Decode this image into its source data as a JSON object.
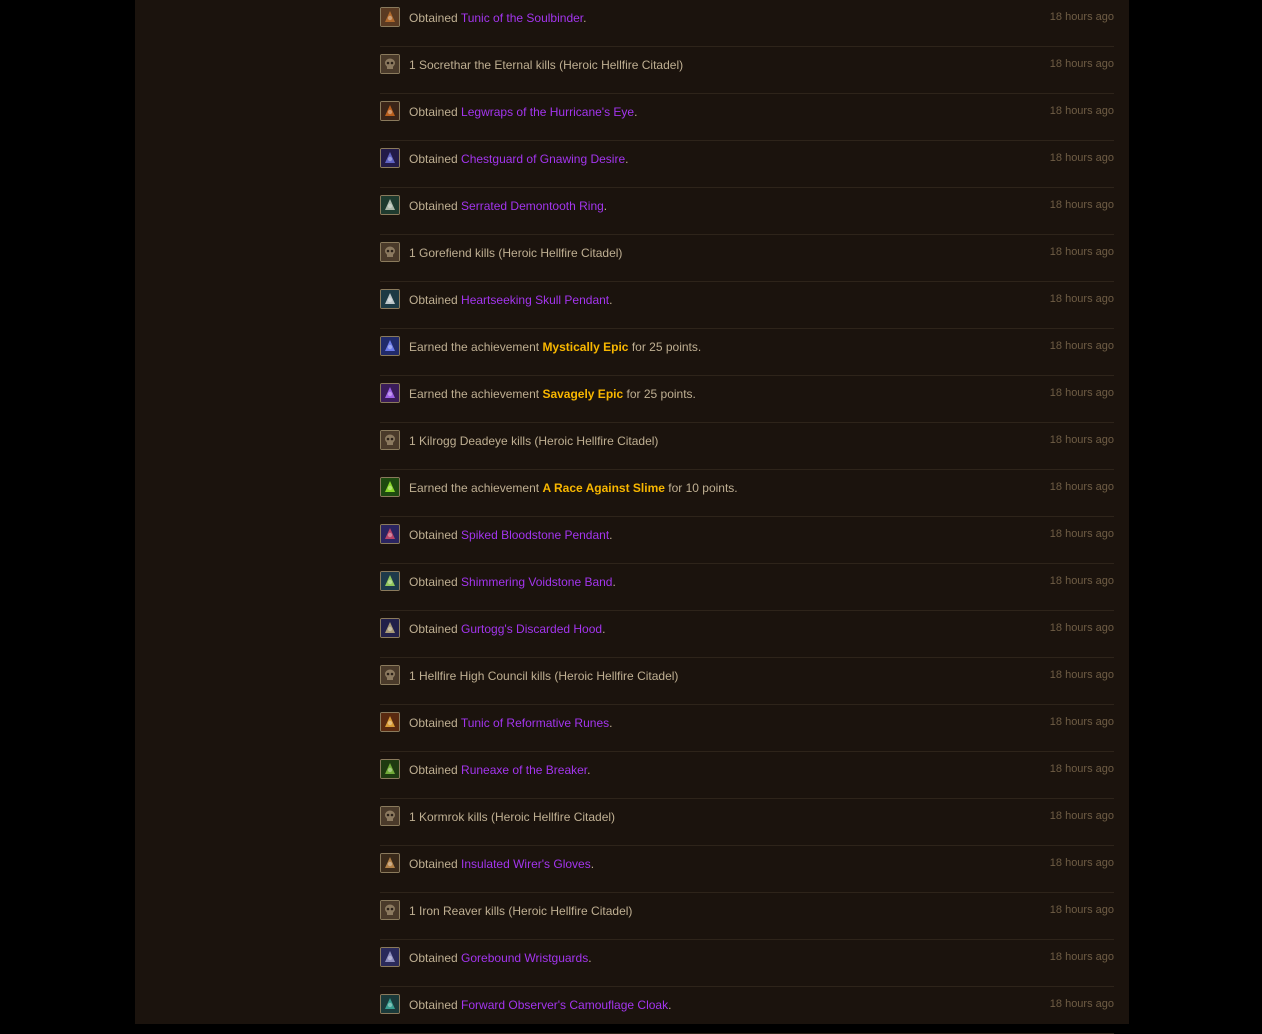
{
  "colors": {
    "epic_item": "#a335ee",
    "achievement": "#f8b700",
    "text": "#bfaf92",
    "time": "#6f5d45",
    "background": "#1b130d"
  },
  "activity": [
    {
      "type": "loot",
      "icon": "chest-armor-icon",
      "prefix": "Obtained",
      "name": "Tunic of the Soulbinder",
      "suffix": ".",
      "time": "18 hours ago"
    },
    {
      "type": "kill",
      "icon": "skull-icon",
      "text": "1 Socrethar the Eternal kills (Heroic Hellfire Citadel)",
      "time": "18 hours ago"
    },
    {
      "type": "loot",
      "icon": "leg-armor-icon",
      "prefix": "Obtained",
      "name": "Legwraps of the Hurricane's Eye",
      "suffix": ".",
      "time": "18 hours ago"
    },
    {
      "type": "loot",
      "icon": "chest-armor-icon",
      "prefix": "Obtained",
      "name": "Chestguard of Gnawing Desire",
      "suffix": ".",
      "time": "18 hours ago"
    },
    {
      "type": "loot",
      "icon": "ring-icon",
      "prefix": "Obtained",
      "name": "Serrated Demontooth Ring",
      "suffix": ".",
      "time": "18 hours ago"
    },
    {
      "type": "kill",
      "icon": "skull-icon",
      "text": "1 Gorefiend kills (Heroic Hellfire Citadel)",
      "time": "18 hours ago"
    },
    {
      "type": "loot",
      "icon": "necklace-icon",
      "prefix": "Obtained",
      "name": "Heartseeking Skull Pendant",
      "suffix": ".",
      "time": "18 hours ago"
    },
    {
      "type": "achievement",
      "icon": "achievement-icon",
      "prefix": "Earned the achievement",
      "name": "Mystically Epic",
      "suffix": "for 25 points.",
      "time": "18 hours ago"
    },
    {
      "type": "achievement",
      "icon": "achievement-icon",
      "prefix": "Earned the achievement",
      "name": "Savagely Epic",
      "suffix": "for 25 points.",
      "time": "18 hours ago"
    },
    {
      "type": "kill",
      "icon": "skull-icon",
      "text": "1 Kilrogg Deadeye kills (Heroic Hellfire Citadel)",
      "time": "18 hours ago"
    },
    {
      "type": "achievement",
      "icon": "achievement-icon",
      "prefix": "Earned the achievement",
      "name": "A Race Against Slime",
      "suffix": "for 10 points.",
      "time": "18 hours ago"
    },
    {
      "type": "loot",
      "icon": "necklace-icon",
      "prefix": "Obtained",
      "name": "Spiked Bloodstone Pendant",
      "suffix": ".",
      "time": "18 hours ago"
    },
    {
      "type": "loot",
      "icon": "ring-icon",
      "prefix": "Obtained",
      "name": "Shimmering Voidstone Band",
      "suffix": ".",
      "time": "18 hours ago"
    },
    {
      "type": "loot",
      "icon": "helm-icon",
      "prefix": "Obtained",
      "name": "Gurtogg's Discarded Hood",
      "suffix": ".",
      "time": "18 hours ago"
    },
    {
      "type": "kill",
      "icon": "skull-icon",
      "text": "1 Hellfire High Council kills (Heroic Hellfire Citadel)",
      "time": "18 hours ago"
    },
    {
      "type": "loot",
      "icon": "chest-armor-icon",
      "prefix": "Obtained",
      "name": "Tunic of Reformative Runes",
      "suffix": ".",
      "time": "18 hours ago"
    },
    {
      "type": "loot",
      "icon": "axe-icon",
      "prefix": "Obtained",
      "name": "Runeaxe of the Breaker",
      "suffix": ".",
      "time": "18 hours ago"
    },
    {
      "type": "kill",
      "icon": "skull-icon",
      "text": "1 Kormrok kills (Heroic Hellfire Citadel)",
      "time": "18 hours ago"
    },
    {
      "type": "loot",
      "icon": "gloves-icon",
      "prefix": "Obtained",
      "name": "Insulated Wirer's Gloves",
      "suffix": ".",
      "time": "18 hours ago"
    },
    {
      "type": "kill",
      "icon": "skull-icon",
      "text": "1 Iron Reaver kills (Heroic Hellfire Citadel)",
      "time": "18 hours ago"
    },
    {
      "type": "loot",
      "icon": "bracers-icon",
      "prefix": "Obtained",
      "name": "Gorebound Wristguards",
      "suffix": ".",
      "time": "18 hours ago"
    },
    {
      "type": "loot",
      "icon": "cloak-icon",
      "prefix": "Obtained",
      "name": "Forward Observer's Camouflage Cloak",
      "suffix": ".",
      "time": "18 hours ago"
    }
  ]
}
